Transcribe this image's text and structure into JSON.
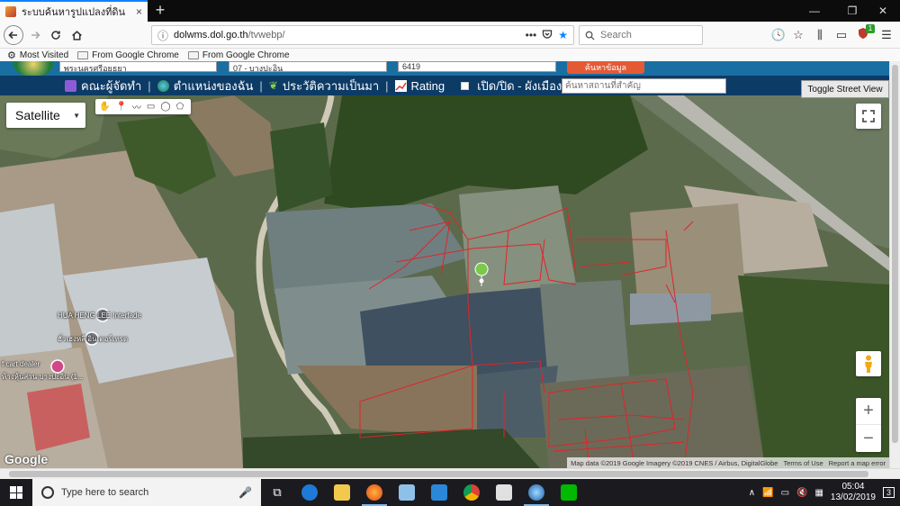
{
  "browser": {
    "tab_title": "ระบบค้นหารูปแปลงที่ดิน",
    "tab_close": "×",
    "new_tab": "+",
    "url_host": "dolwms.dol.go.th",
    "url_path": "/tvwebp/",
    "url_more": "•••",
    "search_placeholder": "Search",
    "extension_badge": "1",
    "window_controls": {
      "minimize": "—",
      "maximize": "❐",
      "close": "✕"
    }
  },
  "bookmarks": [
    {
      "label": "Most Visited",
      "icon": "gear-icon"
    },
    {
      "label": "From Google Chrome",
      "icon": "folder-icon"
    },
    {
      "label": "From Google Chrome",
      "icon": "folder-icon"
    }
  ],
  "header_fields": {
    "province": "พระนครศรีอยุธยา",
    "amphoe": "07 - บางปะอิน",
    "parcel": "6419",
    "search_button": "ค้นหาข้อมูล"
  },
  "toolbar": {
    "items": [
      {
        "label": "คณะผู้จัดทำ",
        "icon": "people-icon"
      },
      {
        "label": "ตำแหน่งของฉัน",
        "icon": "globe-icon"
      },
      {
        "label": "ประวัติความเป็นมา",
        "icon": "sprout-icon"
      },
      {
        "label": "Rating",
        "icon": "chart-icon"
      },
      {
        "label": "เปิด/ปิด - ผังเมือง",
        "icon": "checkbox-icon"
      }
    ],
    "separator": "|",
    "place_search_placeholder": "ค้นหาสถานที่สำคัญ"
  },
  "map": {
    "type_selected": "Satellite",
    "street_view_toggle": "Toggle Street View",
    "zoom_in": "+",
    "zoom_out": "−",
    "google_logo": "Google",
    "attribution": {
      "data": "Map data ©2019 Google Imagery ©2019 CNES / Airbus, DigitalGlobe",
      "terms": "Terms of Use",
      "report": "Report a map error"
    },
    "poi": [
      {
        "label": "HUA HENG LEE Interfade"
      },
      {
        "label": "ฮั่วเฮงหลี อินเตอร์เทรด"
      },
      {
        "label": "f cart dealer"
      },
      {
        "label": "ห้างหุ้นส่วน บางปะอิน (1..."
      }
    ]
  },
  "taskbar": {
    "search_placeholder": "Type here to search",
    "time": "05:04",
    "date": "13/02/2019",
    "notification_count": "3"
  }
}
